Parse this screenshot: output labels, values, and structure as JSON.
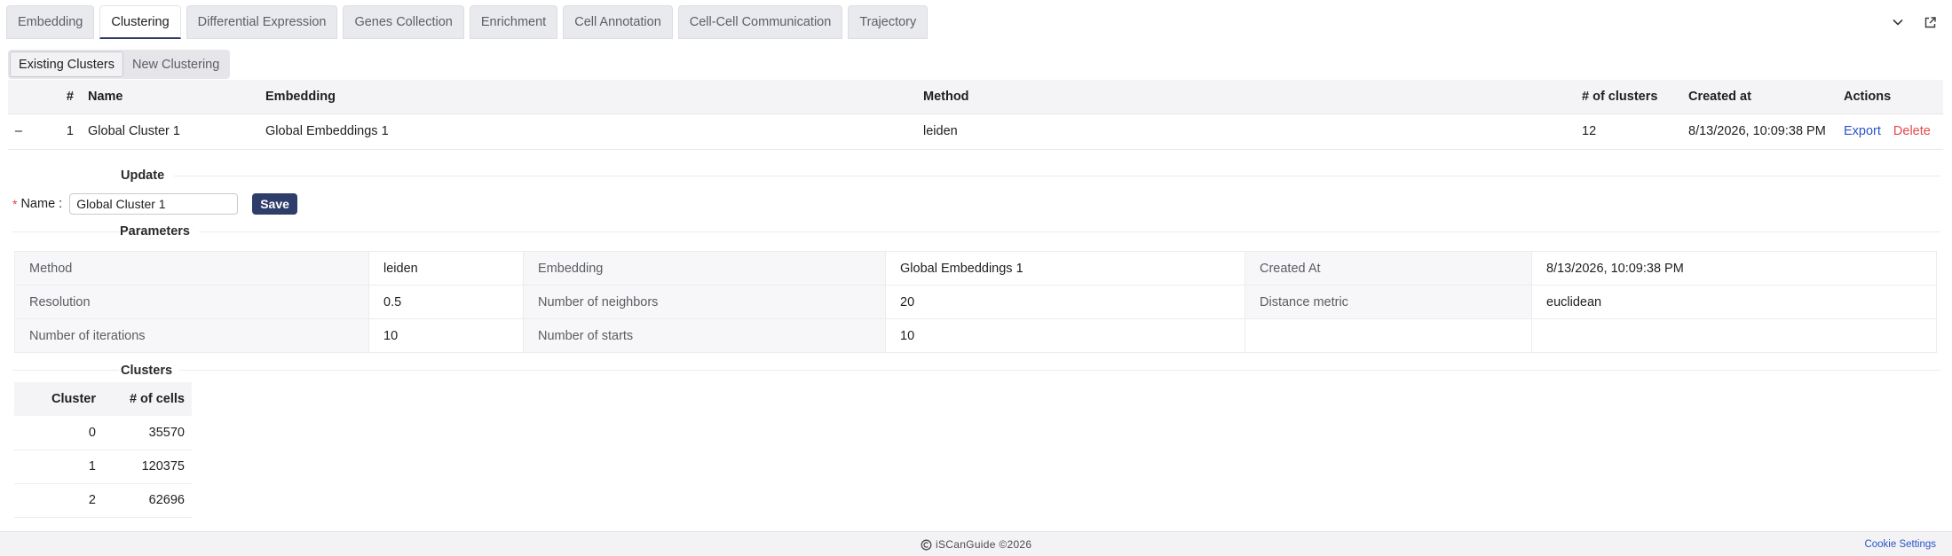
{
  "tabs": [
    "Embedding",
    "Clustering",
    "Differential Expression",
    "Genes Collection",
    "Enrichment",
    "Cell Annotation",
    "Cell-Cell Communication",
    "Trajectory"
  ],
  "subtabs": [
    "Existing Clusters",
    "New Clustering"
  ],
  "table": {
    "headers": [
      "#",
      "Name",
      "Embedding",
      "Method",
      "# of clusters",
      "Created at",
      "Actions"
    ],
    "row": {
      "collapse": "–",
      "index": "1",
      "name": "Global Cluster 1",
      "embedding": "Global Embeddings 1",
      "method": "leiden",
      "num_clusters": "12",
      "created_at": "8/13/2026, 10:09:38 PM",
      "export": "Export",
      "delete": "Delete"
    }
  },
  "update": {
    "title": "Update",
    "required_mark": "*",
    "name_label": "Name",
    "name_value": "Global Cluster 1",
    "save": "Save"
  },
  "parameters": {
    "title": "Parameters",
    "rows": [
      [
        "Method",
        "leiden",
        "Embedding",
        "Global Embeddings 1",
        "Created At",
        "8/13/2026, 10:09:38 PM"
      ],
      [
        "Resolution",
        "0.5",
        "Number of neighbors",
        "20",
        "Distance metric",
        "euclidean"
      ],
      [
        "Number of iterations",
        "10",
        "Number of starts",
        "10",
        "",
        ""
      ]
    ]
  },
  "clusters": {
    "title": "Clusters",
    "headers": [
      "Cluster",
      "# of cells"
    ],
    "rows": [
      [
        "0",
        "35570"
      ],
      [
        "1",
        "120375"
      ],
      [
        "2",
        "62696"
      ]
    ]
  },
  "footer": {
    "copyright": "iSCanGuide ©2026",
    "cookie": "Cookie Settings"
  },
  "colors": {
    "accent": "#2f3d6b",
    "link": "#2a55c8",
    "danger": "#e34b4b"
  }
}
